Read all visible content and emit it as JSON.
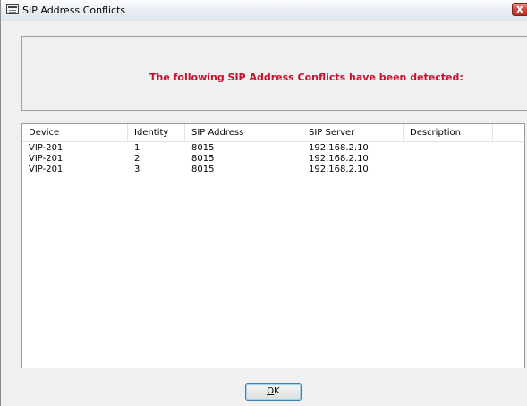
{
  "window": {
    "title": "SIP Address Conflicts",
    "close_label": "x"
  },
  "header": {
    "message": "The following SIP Address Conflicts have been detected:",
    "message_color": "#c8102e"
  },
  "table": {
    "columns": [
      "Device",
      "Identity",
      "SIP Address",
      "SIP Server",
      "Description"
    ],
    "rows": [
      [
        "VIP-201",
        "1",
        "8015",
        "192.168.2.10",
        ""
      ],
      [
        "VIP-201",
        "2",
        "8015",
        "192.168.2.10",
        ""
      ],
      [
        "VIP-201",
        "3",
        "8015",
        "192.168.2.10",
        ""
      ]
    ]
  },
  "buttons": {
    "ok_mnemonic": "O",
    "ok_rest": "K"
  }
}
